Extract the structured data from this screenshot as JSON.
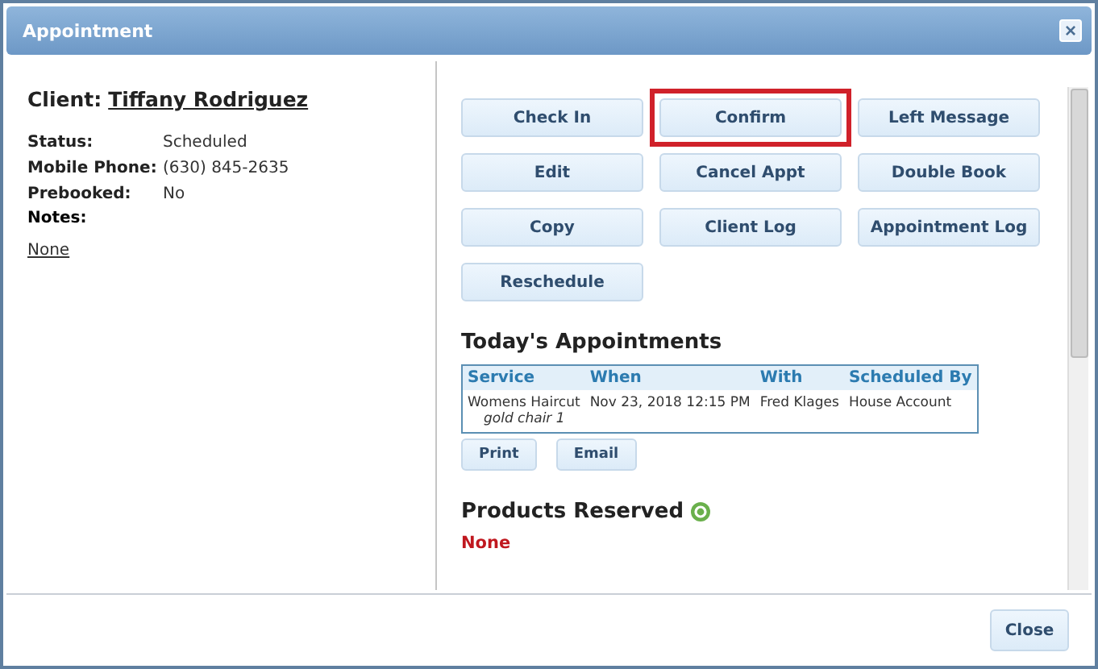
{
  "window": {
    "title": "Appointment",
    "close_icon": "×"
  },
  "client": {
    "label": "Client:",
    "name": "Tiffany Rodriguez"
  },
  "details": [
    {
      "label": "Status:",
      "value": "Scheduled"
    },
    {
      "label": "Mobile Phone:",
      "value": "(630) 845-2635"
    },
    {
      "label": "Prebooked:",
      "value": "No"
    }
  ],
  "notes": {
    "label": "Notes:",
    "value": "None"
  },
  "actions": [
    {
      "label": "Check In",
      "highlighted": false
    },
    {
      "label": "Confirm",
      "highlighted": true
    },
    {
      "label": "Left Message",
      "highlighted": false
    },
    {
      "label": "Edit",
      "highlighted": false
    },
    {
      "label": "Cancel Appt",
      "highlighted": false
    },
    {
      "label": "Double Book",
      "highlighted": false
    },
    {
      "label": "Copy",
      "highlighted": false
    },
    {
      "label": "Client Log",
      "highlighted": false
    },
    {
      "label": "Appointment Log",
      "highlighted": false
    },
    {
      "label": "Reschedule",
      "highlighted": false
    }
  ],
  "todays_appointments": {
    "title": "Today's Appointments",
    "columns": [
      "Service",
      "When",
      "With",
      "Scheduled By"
    ],
    "rows": [
      {
        "service": "Womens Haircut",
        "resource": "gold chair 1",
        "when": "Nov 23, 2018 12:15 PM",
        "with": "Fred Klages",
        "scheduled_by": "House Account"
      }
    ],
    "buttons": [
      "Print",
      "Email"
    ]
  },
  "products_reserved": {
    "title": "Products Reserved",
    "value": "None"
  },
  "footer": {
    "buttons": [
      "Close"
    ]
  }
}
